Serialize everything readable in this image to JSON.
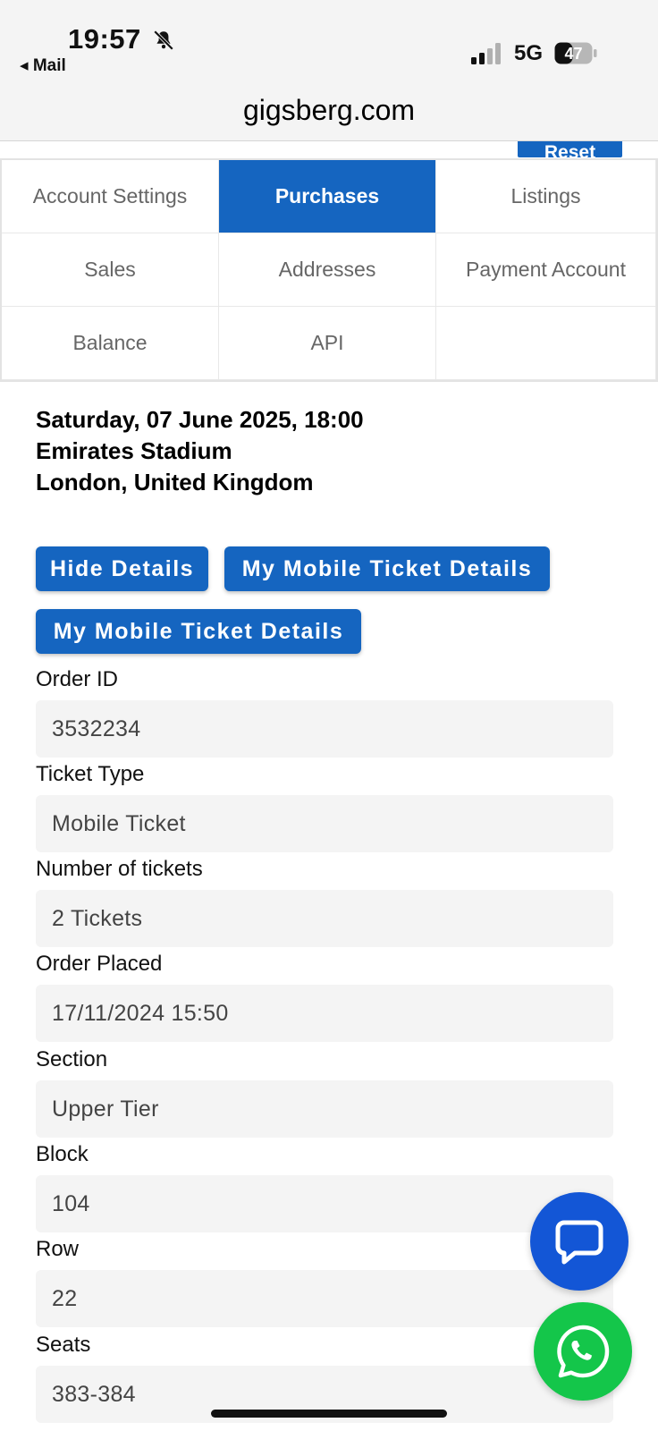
{
  "status_bar": {
    "time": "19:57",
    "back_label": "◂ Mail",
    "network": "5G",
    "battery": "47"
  },
  "browser": {
    "url": "gigsberg.com"
  },
  "reset_label": "Reset",
  "tabs": [
    {
      "label": "Account Settings",
      "active": false
    },
    {
      "label": "Purchases",
      "active": true
    },
    {
      "label": "Listings",
      "active": false
    },
    {
      "label": "Sales",
      "active": false
    },
    {
      "label": "Addresses",
      "active": false
    },
    {
      "label": "Payment Account",
      "active": false
    },
    {
      "label": "Balance",
      "active": false
    },
    {
      "label": "API",
      "active": false
    }
  ],
  "event": {
    "datetime": "Saturday, 07 June 2025, 18:00",
    "venue": "Emirates Stadium",
    "location": "London, United Kingdom"
  },
  "buttons": {
    "hide_details": "Hide Details",
    "mobile_ticket_1": "My Mobile Ticket Details",
    "mobile_ticket_2": "My Mobile Ticket Details"
  },
  "fields": [
    {
      "label": "Order ID",
      "value": "3532234"
    },
    {
      "label": "Ticket Type",
      "value": "Mobile Ticket"
    },
    {
      "label": "Number of tickets",
      "value": "2 Tickets"
    },
    {
      "label": "Order Placed",
      "value": "17/11/2024 15:50"
    },
    {
      "label": "Section",
      "value": "Upper Tier"
    },
    {
      "label": "Block",
      "value": "104"
    },
    {
      "label": "Row",
      "value": "22"
    },
    {
      "label": "Seats",
      "value": "383-384"
    }
  ],
  "colors": {
    "primary": "#1565c0",
    "chat": "#1356d6",
    "whatsapp": "#14c64a",
    "field_bg": "#f4f4f4"
  }
}
